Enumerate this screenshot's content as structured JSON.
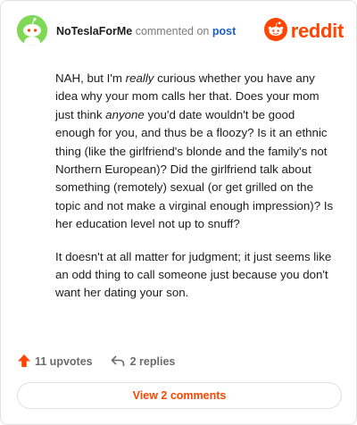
{
  "header": {
    "username": "NoTeslaForMe",
    "action_text": "commented on",
    "post_link": "post",
    "logo_text": "reddit",
    "avatar_icon": "snoo-avatar-icon",
    "logo_icon": "reddit-alien-icon"
  },
  "comment": {
    "paragraphs": [
      {
        "segments": [
          {
            "text": "NAH, but I'm ",
            "italic": false
          },
          {
            "text": "really",
            "italic": true
          },
          {
            "text": " curious whether you have any idea why your mom calls her that. Does your mom just think ",
            "italic": false
          },
          {
            "text": "anyone",
            "italic": true
          },
          {
            "text": " you'd date wouldn't be good enough for you, and thus be a floozy? Is it an ethnic thing (like the girlfriend's blonde and the family's not Northern European)? Did the girlfriend talk about something (remotely) sexual (or get grilled on the topic and not make a virginal enough impression)? Is her education level not up to snuff?",
            "italic": false
          }
        ]
      },
      {
        "segments": [
          {
            "text": "It doesn't at all matter for judgment; it just seems like an odd thing to call someone just because you don't want her dating your son.",
            "italic": false
          }
        ]
      }
    ]
  },
  "footer": {
    "upvotes_label": "11 upvotes",
    "replies_label": "2 replies",
    "view_comments_label": "View 2 comments",
    "upvote_icon": "upvote-arrow-icon",
    "reply_icon": "reply-arrow-icon"
  },
  "colors": {
    "brand": "#ff4500",
    "link": "#1a5fbf",
    "avatar_bg": "#7ed957"
  }
}
